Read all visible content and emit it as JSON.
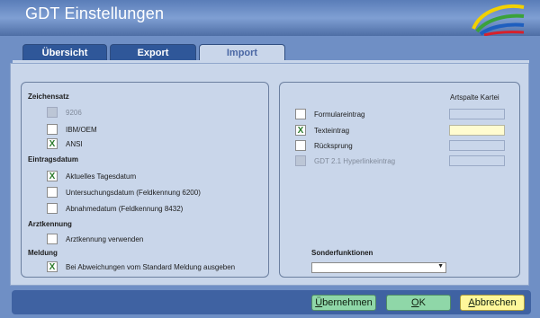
{
  "window": {
    "title": "GDT Einstellungen"
  },
  "tabs": [
    {
      "label": "Übersicht"
    },
    {
      "label": "Export"
    },
    {
      "label": "Import"
    }
  ],
  "left_group": {
    "zeichensatz": {
      "title": "Zeichensatz",
      "options": [
        {
          "label": "9206",
          "checked": false,
          "disabled": true
        },
        {
          "label": "IBM/OEM",
          "checked": false,
          "disabled": false
        },
        {
          "label": "ANSI",
          "checked": true,
          "disabled": false
        }
      ]
    },
    "eintragsdatum": {
      "title": "Eintragsdatum",
      "options": [
        {
          "label": "Aktuelles Tagesdatum",
          "checked": true
        },
        {
          "label": "Untersuchungsdatum (Feldkennung 6200)",
          "checked": false
        },
        {
          "label": "Abnahmedatum (Feldkennung 8432)",
          "checked": false
        }
      ]
    },
    "arztkennung": {
      "title": "Arztkennung",
      "options": [
        {
          "label": "Arztkennung verwenden",
          "checked": false
        }
      ]
    },
    "meldung": {
      "title": "Meldung",
      "options": [
        {
          "label": "Bei Abweichungen vom Standard Meldung ausgeben",
          "checked": true
        }
      ]
    }
  },
  "right_group": {
    "column_header": "Artspalte Kartei",
    "entries": [
      {
        "label": "Formulareintrag",
        "checked": false,
        "disabled": false,
        "field_active": false
      },
      {
        "label": "Texteintrag",
        "checked": true,
        "disabled": false,
        "field_active": true
      },
      {
        "label": "Rücksprung",
        "checked": false,
        "disabled": false,
        "field_active": false
      },
      {
        "label": "GDT 2.1 Hyperlinkeintrag",
        "checked": false,
        "disabled": true,
        "field_active": false
      }
    ],
    "sonderfunktionen": {
      "title": "Sonderfunktionen",
      "selected": ""
    }
  },
  "checkmark": "X",
  "buttons": {
    "uebernehmen": {
      "underline": "Ü",
      "rest": "bernehmen"
    },
    "ok": {
      "underline": "O",
      "rest": "K"
    },
    "abbrechen": {
      "underline": "A",
      "rest": "bbrechen"
    }
  }
}
